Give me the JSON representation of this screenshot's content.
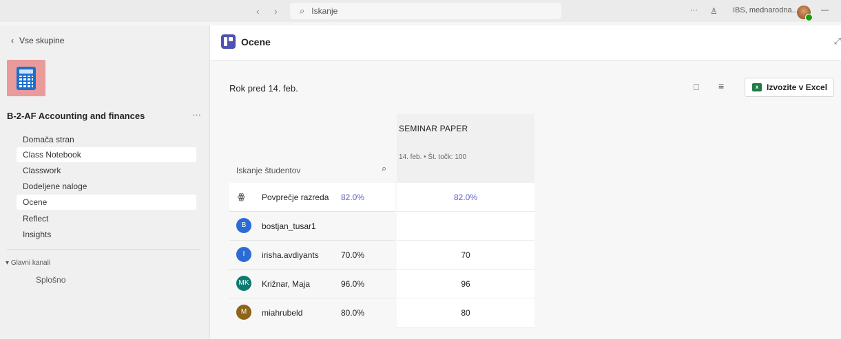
{
  "topbar": {
    "back_arrow": "‹",
    "forward_arrow": "›",
    "search_placeholder": "Iskanje",
    "more": "···",
    "org_name": "IBS, mednarodna...",
    "minimize": "—"
  },
  "sidebar": {
    "back_label": "Vse skupine",
    "team_name": "B-2-AF Accounting and finances",
    "team_more": "···",
    "items": [
      {
        "label": "Domača stran",
        "active": false
      },
      {
        "label": "Class Notebook",
        "active": true
      },
      {
        "label": "Classwork",
        "active": false
      },
      {
        "label": "Dodeljene naloge",
        "active": false
      },
      {
        "label": "Ocene",
        "active": true
      },
      {
        "label": "Reflect",
        "active": false
      },
      {
        "label": "Insights",
        "active": false
      }
    ],
    "channels_header": "Glavni kanali",
    "channels": [
      "Splošno"
    ]
  },
  "main": {
    "title": "Ocene",
    "due_label": "Rok pred 14. feb.",
    "export_label": "Izvozite v Excel",
    "search_students_placeholder": "Iskanje študentov",
    "assignment": {
      "title": "SEMINAR PAPER",
      "meta": "14. feb. • Št. točk: 100"
    },
    "average": {
      "label": "Povprečje razreda",
      "percent": "82.0%",
      "score": "82.0%"
    },
    "students": [
      {
        "initials": "B",
        "name": "bostjan_tusar1",
        "percent": "",
        "score": "",
        "color": "#2b6cd4"
      },
      {
        "initials": "I",
        "name": "irisha.avdiyants",
        "percent": "70.0%",
        "score": "70",
        "color": "#2b6cd4"
      },
      {
        "initials": "MK",
        "name": "Križnar, Maja",
        "percent": "96.0%",
        "score": "96",
        "color": "#0d7a6f"
      },
      {
        "initials": "M",
        "name": "miahrubeld",
        "percent": "80.0%",
        "score": "80",
        "color": "#8e6419"
      }
    ]
  },
  "colors": {
    "accent": "#5b5fc7",
    "excel_green": "#1f7a44",
    "team_tile": "#e99a9a"
  }
}
